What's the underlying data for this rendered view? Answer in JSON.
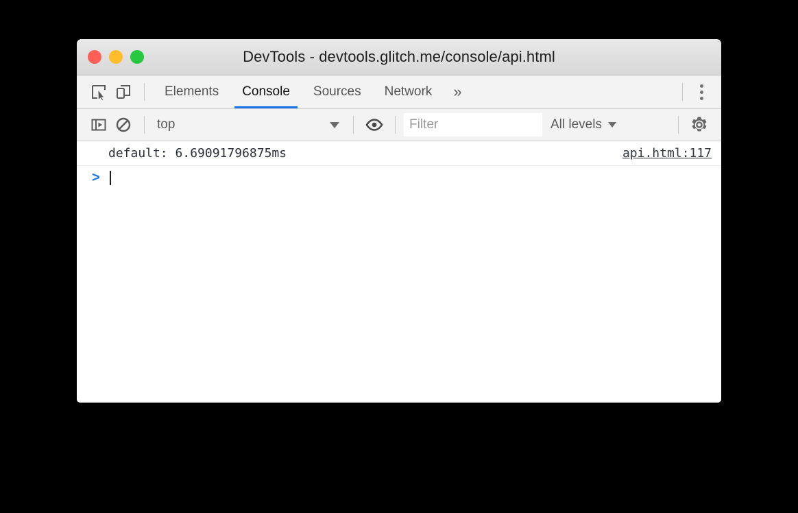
{
  "window": {
    "title": "DevTools - devtools.glitch.me/console/api.html",
    "traffic_lights": {
      "close_color": "#ff5f56",
      "minimize_color": "#ffbd2e",
      "maximize_color": "#28c840"
    }
  },
  "tabstrip": {
    "inspect_icon": "inspect-element-icon",
    "device_icon": "device-toolbar-icon",
    "tabs": [
      {
        "label": "Elements",
        "active": false
      },
      {
        "label": "Console",
        "active": true
      },
      {
        "label": "Sources",
        "active": false
      },
      {
        "label": "Network",
        "active": false
      }
    ],
    "overflow_label": "»",
    "menu_icon": "kebab-menu-icon",
    "active_underline_color": "#1a73e8"
  },
  "console_toolbar": {
    "sidebar_icon": "show-console-sidebar-icon",
    "clear_icon": "clear-console-icon",
    "context_selected": "top",
    "eye_icon": "live-expression-eye-icon",
    "filter_value": "",
    "filter_placeholder": "Filter",
    "levels_label": "All levels",
    "settings_icon": "settings-gear-icon"
  },
  "console": {
    "messages": [
      {
        "text": "default: 6.69091796875ms",
        "source": "api.html:117"
      }
    ],
    "prompt_symbol": ">",
    "prompt_value": ""
  }
}
